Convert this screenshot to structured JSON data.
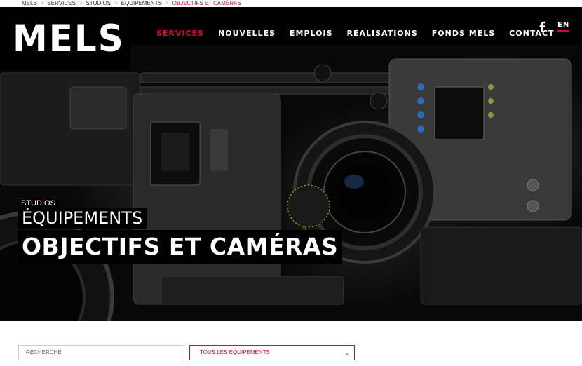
{
  "breadcrumb": {
    "items": [
      "MELS",
      "SERVICES",
      "STUDIOS",
      "ÉQUIPEMENTS",
      "OBJECTIFS ET CAMÉRAS"
    ]
  },
  "header": {
    "logo": "MELS",
    "nav": [
      "SERVICES",
      "NOUVELLES",
      "EMPLOIS",
      "RÉALISATIONS",
      "FONDS MELS",
      "CONTACT"
    ],
    "active_nav": "SERVICES",
    "social_icon": "facebook-icon",
    "lang": "EN"
  },
  "hero": {
    "tag": "STUDIOS",
    "subtitle": "ÉQUIPEMENTS",
    "title": "OBJECTIFS ET CAMÉRAS"
  },
  "filters": {
    "search_placeholder": "RECHERCHE",
    "select_value": "TOUS LES ÉQUIPEMENTS"
  },
  "colors": {
    "accent": "#c8102e",
    "header_bg": "#000000"
  }
}
